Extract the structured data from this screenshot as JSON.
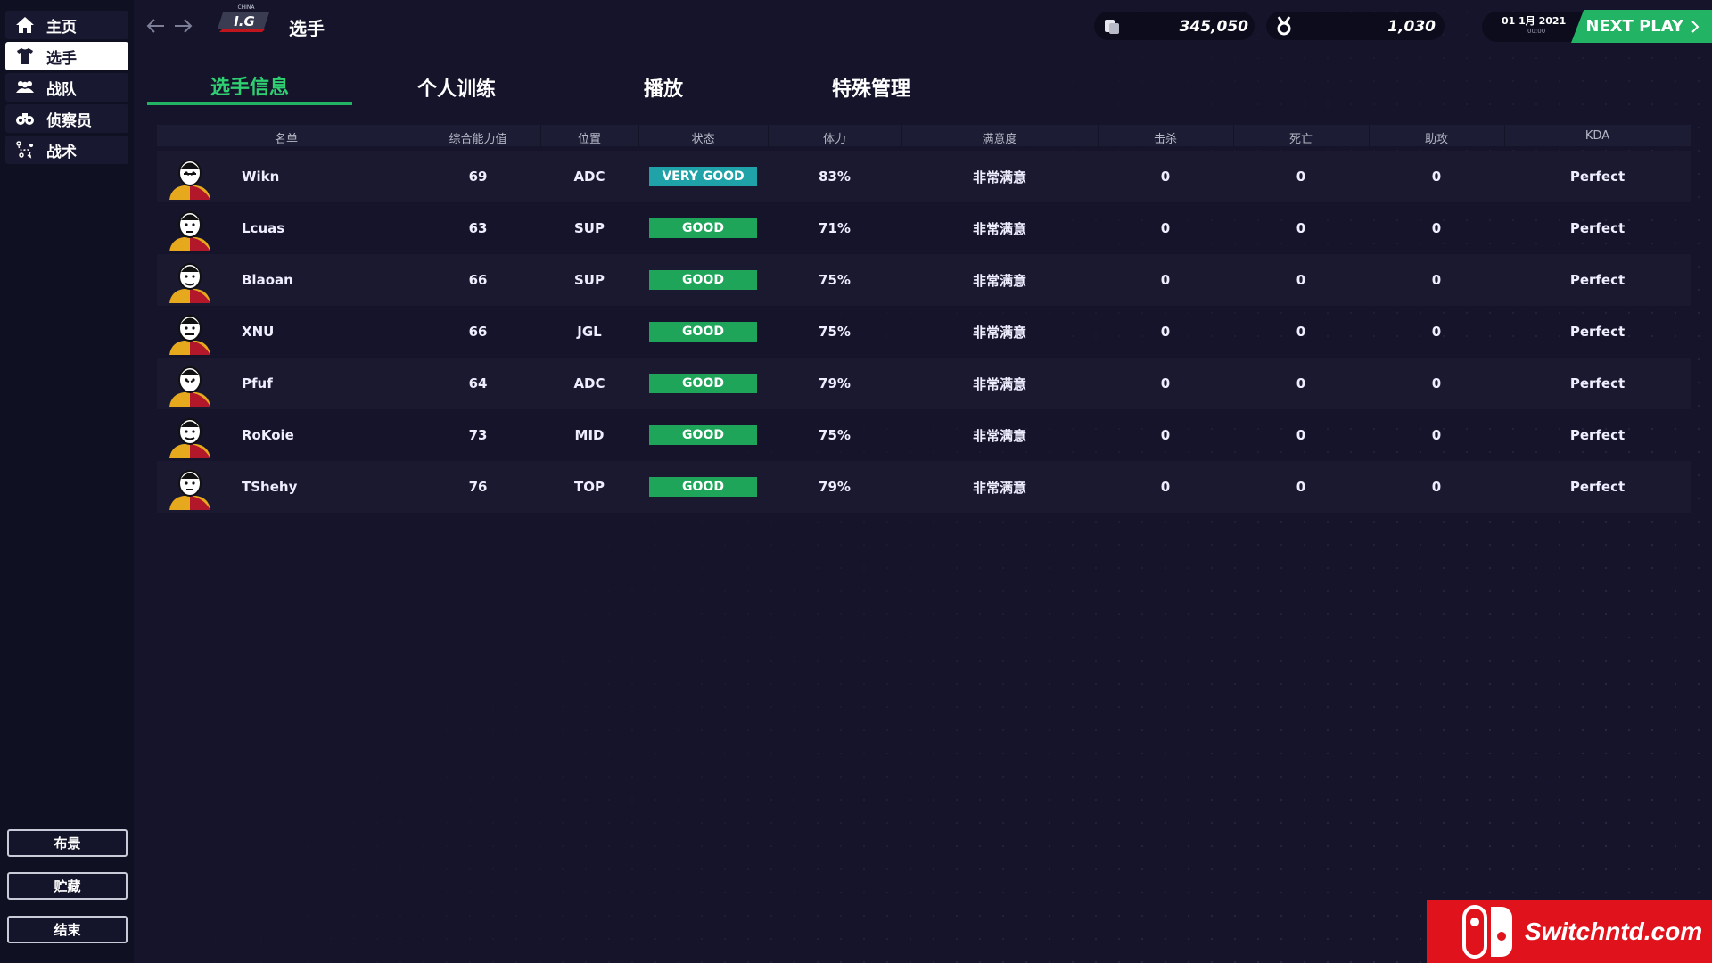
{
  "header": {
    "title": "选手",
    "logo_text": "I.G",
    "logo_sub": "CHINA",
    "money": "345,050",
    "fans": "1,030",
    "date": "01 1月 2021",
    "date_sub": "00:00",
    "next_play": "NEXT PLAY"
  },
  "sidebar": {
    "items": [
      {
        "label": "主页",
        "icon": "home-icon"
      },
      {
        "label": "选手",
        "icon": "jersey-icon"
      },
      {
        "label": "战队",
        "icon": "team-icon"
      },
      {
        "label": "侦察员",
        "icon": "binoculars-icon"
      },
      {
        "label": "战术",
        "icon": "tactics-icon"
      }
    ],
    "bottom_buttons": [
      "布景",
      "贮藏",
      "结束"
    ]
  },
  "tabs": [
    "选手信息",
    "个人训练",
    "播放",
    "特殊管理"
  ],
  "table": {
    "columns": [
      "名单",
      "综合能力值",
      "位置",
      "状态",
      "体力",
      "满意度",
      "击杀",
      "死亡",
      "助攻",
      "KDA"
    ],
    "rows": [
      {
        "name": "Wikn",
        "rating": "69",
        "pos": "ADC",
        "status": "VERY GOOD",
        "stamina": "83%",
        "satisfaction": "非常满意",
        "kills": "0",
        "deaths": "0",
        "assists": "0",
        "kda": "Perfect"
      },
      {
        "name": "Lcuas",
        "rating": "63",
        "pos": "SUP",
        "status": "GOOD",
        "stamina": "71%",
        "satisfaction": "非常满意",
        "kills": "0",
        "deaths": "0",
        "assists": "0",
        "kda": "Perfect"
      },
      {
        "name": "Blaoan",
        "rating": "66",
        "pos": "SUP",
        "status": "GOOD",
        "stamina": "75%",
        "satisfaction": "非常满意",
        "kills": "0",
        "deaths": "0",
        "assists": "0",
        "kda": "Perfect"
      },
      {
        "name": "XNU",
        "rating": "66",
        "pos": "JGL",
        "status": "GOOD",
        "stamina": "75%",
        "satisfaction": "非常满意",
        "kills": "0",
        "deaths": "0",
        "assists": "0",
        "kda": "Perfect"
      },
      {
        "name": "Pfuf",
        "rating": "64",
        "pos": "ADC",
        "status": "GOOD",
        "stamina": "79%",
        "satisfaction": "非常满意",
        "kills": "0",
        "deaths": "0",
        "assists": "0",
        "kda": "Perfect"
      },
      {
        "name": "RoKoie",
        "rating": "73",
        "pos": "MID",
        "status": "GOOD",
        "stamina": "75%",
        "satisfaction": "非常满意",
        "kills": "0",
        "deaths": "0",
        "assists": "0",
        "kda": "Perfect"
      },
      {
        "name": "TShehy",
        "rating": "76",
        "pos": "TOP",
        "status": "GOOD",
        "stamina": "79%",
        "satisfaction": "非常满意",
        "kills": "0",
        "deaths": "0",
        "assists": "0",
        "kda": "Perfect"
      }
    ]
  },
  "watermark": "Switchntd.com",
  "colors": {
    "accent": "#23b364",
    "status_very_good": "#1fa3a8",
    "status_good": "#1fa55a",
    "background": "#15142a",
    "sidebar": "#101023"
  }
}
